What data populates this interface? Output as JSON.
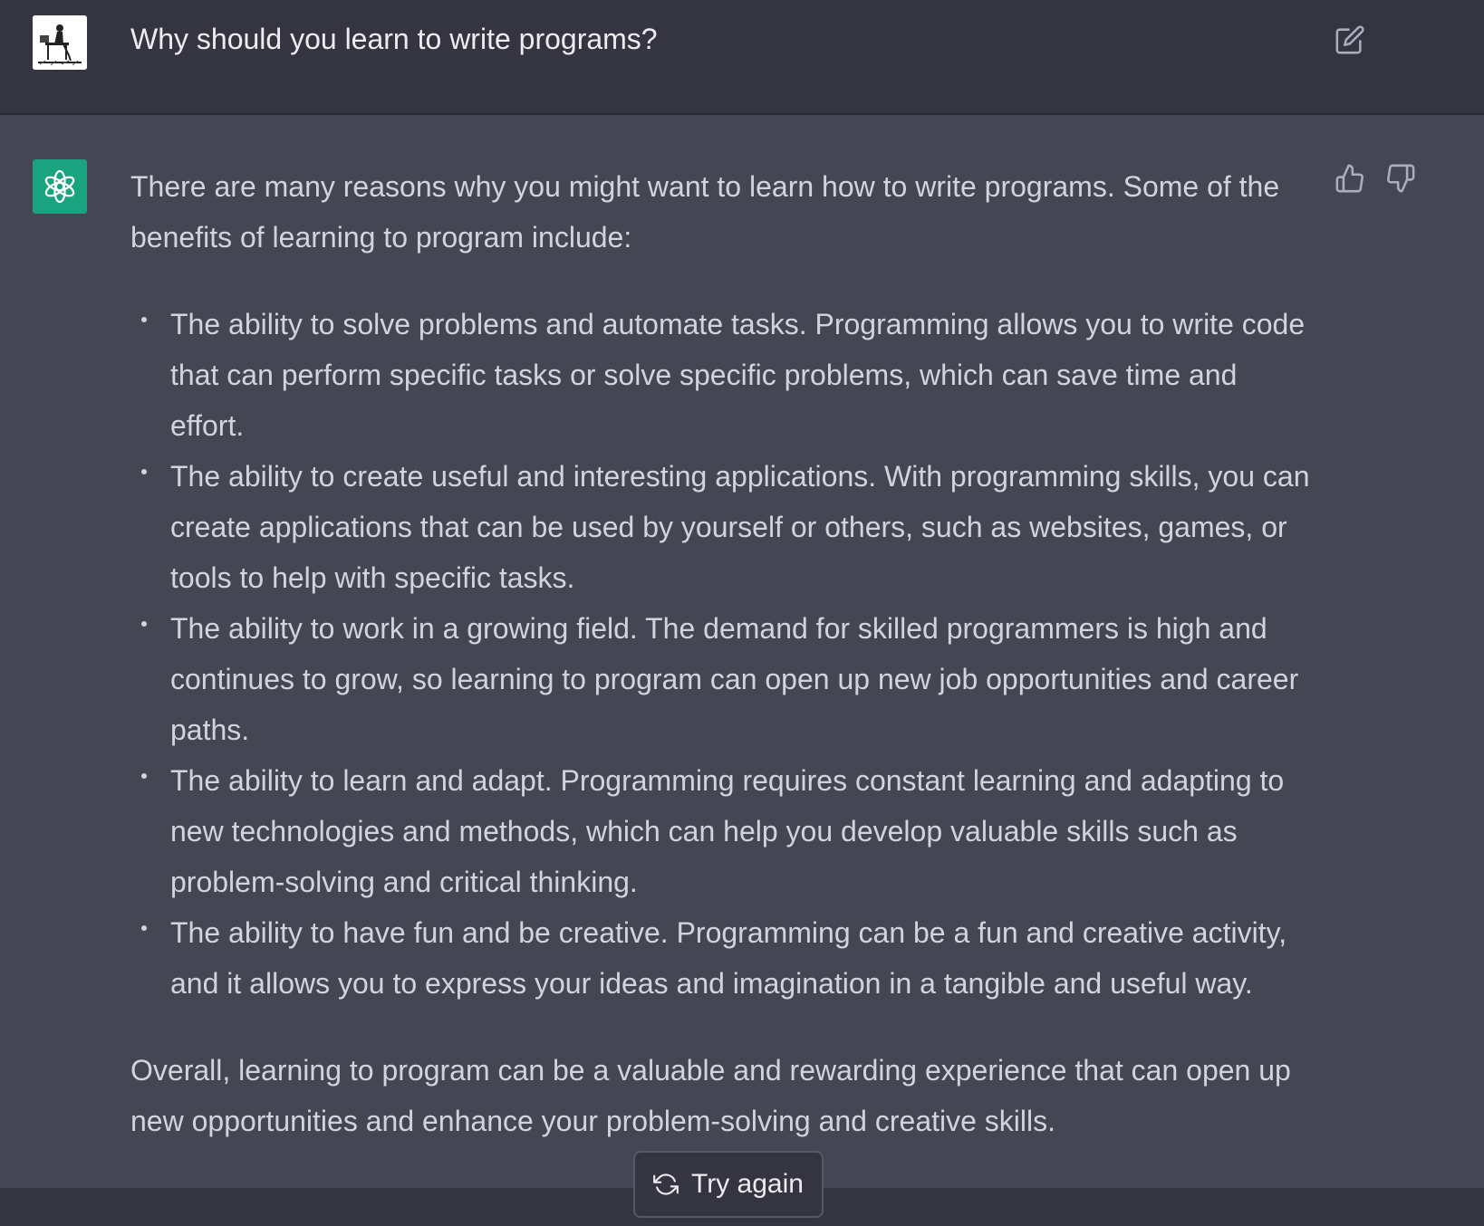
{
  "user_message": {
    "text": "Why should you learn to write programs?",
    "avatar_icon": "user-drawing-avatar",
    "edit_icon": "edit-icon"
  },
  "assistant_message": {
    "avatar_icon": "openai-logo-icon",
    "intro": "There are many reasons why you might want to learn how to write programs. Some of the benefits of learning to program include:",
    "bullets": [
      "The ability to solve problems and automate tasks. Programming allows you to write code that can perform specific tasks or solve specific problems, which can save time and effort.",
      "The ability to create useful and interesting applications. With programming skills, you can create applications that can be used by yourself or others, such as websites, games, or tools to help with specific tasks.",
      "The ability to work in a growing field. The demand for skilled programmers is high and continues to grow, so learning to program can open up new job opportunities and career paths.",
      "The ability to learn and adapt. Programming requires constant learning and adapting to new technologies and methods, which can help you develop valuable skills such as problem-solving and critical thinking.",
      "The ability to have fun and be creative. Programming can be a fun and creative activity, and it allows you to express your ideas and imagination in a tangible and useful way."
    ],
    "conclusion": "Overall, learning to program can be a valuable and rewarding experience that can open up new opportunities and enhance your problem-solving and creative skills.",
    "feedback": {
      "thumbs_up_icon": "thumbs-up-icon",
      "thumbs_down_icon": "thumbs-down-icon"
    }
  },
  "controls": {
    "try_again_label": "Try again",
    "try_again_icon": "refresh-icon"
  },
  "colors": {
    "background": "#343541",
    "assistant_background": "#444654",
    "accent": "#10a37f",
    "text": "#d1d5db"
  }
}
